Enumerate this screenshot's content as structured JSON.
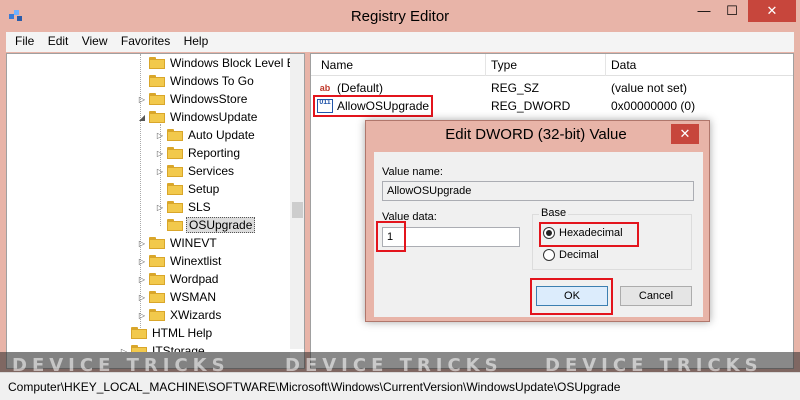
{
  "window": {
    "title": "Registry Editor",
    "min_glyph": "—",
    "max_glyph": "☐",
    "close_glyph": "✕"
  },
  "menu": [
    "File",
    "Edit",
    "View",
    "Favorites",
    "Help"
  ],
  "tree": {
    "items": [
      {
        "label": "Windows Block Level B",
        "expander": ""
      },
      {
        "label": "Windows To Go",
        "expander": ""
      },
      {
        "label": "WindowsStore",
        "expander": "▷"
      },
      {
        "label": "WindowsUpdate",
        "expander": "◢"
      },
      {
        "label": "Auto Update",
        "expander": "▷"
      },
      {
        "label": "Reporting",
        "expander": "▷"
      },
      {
        "label": "Services",
        "expander": "▷"
      },
      {
        "label": "Setup",
        "expander": ""
      },
      {
        "label": "SLS",
        "expander": "▷"
      },
      {
        "label": "OSUpgrade",
        "expander": ""
      },
      {
        "label": "WINEVT",
        "expander": "▷"
      },
      {
        "label": "Winextlist",
        "expander": "▷"
      },
      {
        "label": "Wordpad",
        "expander": "▷"
      },
      {
        "label": "WSMAN",
        "expander": "▷"
      },
      {
        "label": "XWizards",
        "expander": "▷"
      },
      {
        "label": "HTML Help",
        "expander": ""
      },
      {
        "label": "ITStorage",
        "expander": "▷"
      }
    ]
  },
  "list": {
    "columns": [
      "Name",
      "Type",
      "Data"
    ],
    "rows": [
      {
        "icon": "ab",
        "name": "(Default)",
        "type": "REG_SZ",
        "data": "(value not set)"
      },
      {
        "icon": "011",
        "name": "AllowOSUpgrade",
        "type": "REG_DWORD",
        "data": "0x00000000 (0)"
      }
    ]
  },
  "dialog": {
    "title": "Edit DWORD (32-bit) Value",
    "close_glyph": "✕",
    "value_name_label": "Value name:",
    "value_name": "AllowOSUpgrade",
    "value_data_label": "Value data:",
    "value_data": "1",
    "base_label": "Base",
    "hex_label": "Hexadecimal",
    "dec_label": "Decimal",
    "hex_selected": true,
    "ok_label": "OK",
    "cancel_label": "Cancel"
  },
  "status": {
    "path": "Computer\\HKEY_LOCAL_MACHINE\\SOFTWARE\\Microsoft\\Windows\\CurrentVersion\\WindowsUpdate\\OSUpgrade"
  },
  "watermark": {
    "text": "DEVICE TRICKS"
  },
  "colors": {
    "title_bar": "#e8b4a8",
    "close_button": "#c7463c",
    "highlight": "#e3141c",
    "folder": "#f2c94c"
  }
}
